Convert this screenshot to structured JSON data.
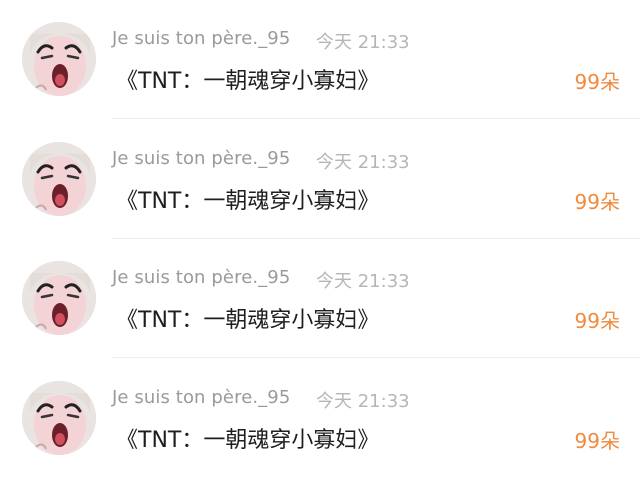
{
  "colors": {
    "username": "#9a9a9a",
    "time": "#b6b6b6",
    "gift_accent": "#f08a3c",
    "divider": "#ededed"
  },
  "items": [
    {
      "avatar_icon": "cartoon-face-avatar-icon",
      "username": "Je suis ton père._95",
      "time": "今天 21:33",
      "title": "《TNT：一朝魂穿小寡妇》",
      "gift": "99朵"
    },
    {
      "avatar_icon": "cartoon-face-avatar-icon",
      "username": "Je suis ton père._95",
      "time": "今天 21:33",
      "title": "《TNT：一朝魂穿小寡妇》",
      "gift": "99朵"
    },
    {
      "avatar_icon": "cartoon-face-avatar-icon",
      "username": "Je suis ton père._95",
      "time": "今天 21:33",
      "title": "《TNT：一朝魂穿小寡妇》",
      "gift": "99朵"
    },
    {
      "avatar_icon": "cartoon-face-avatar-icon",
      "username": "Je suis ton père._95",
      "time": "今天 21:33",
      "title": "《TNT：一朝魂穿小寡妇》",
      "gift": "99朵"
    }
  ]
}
